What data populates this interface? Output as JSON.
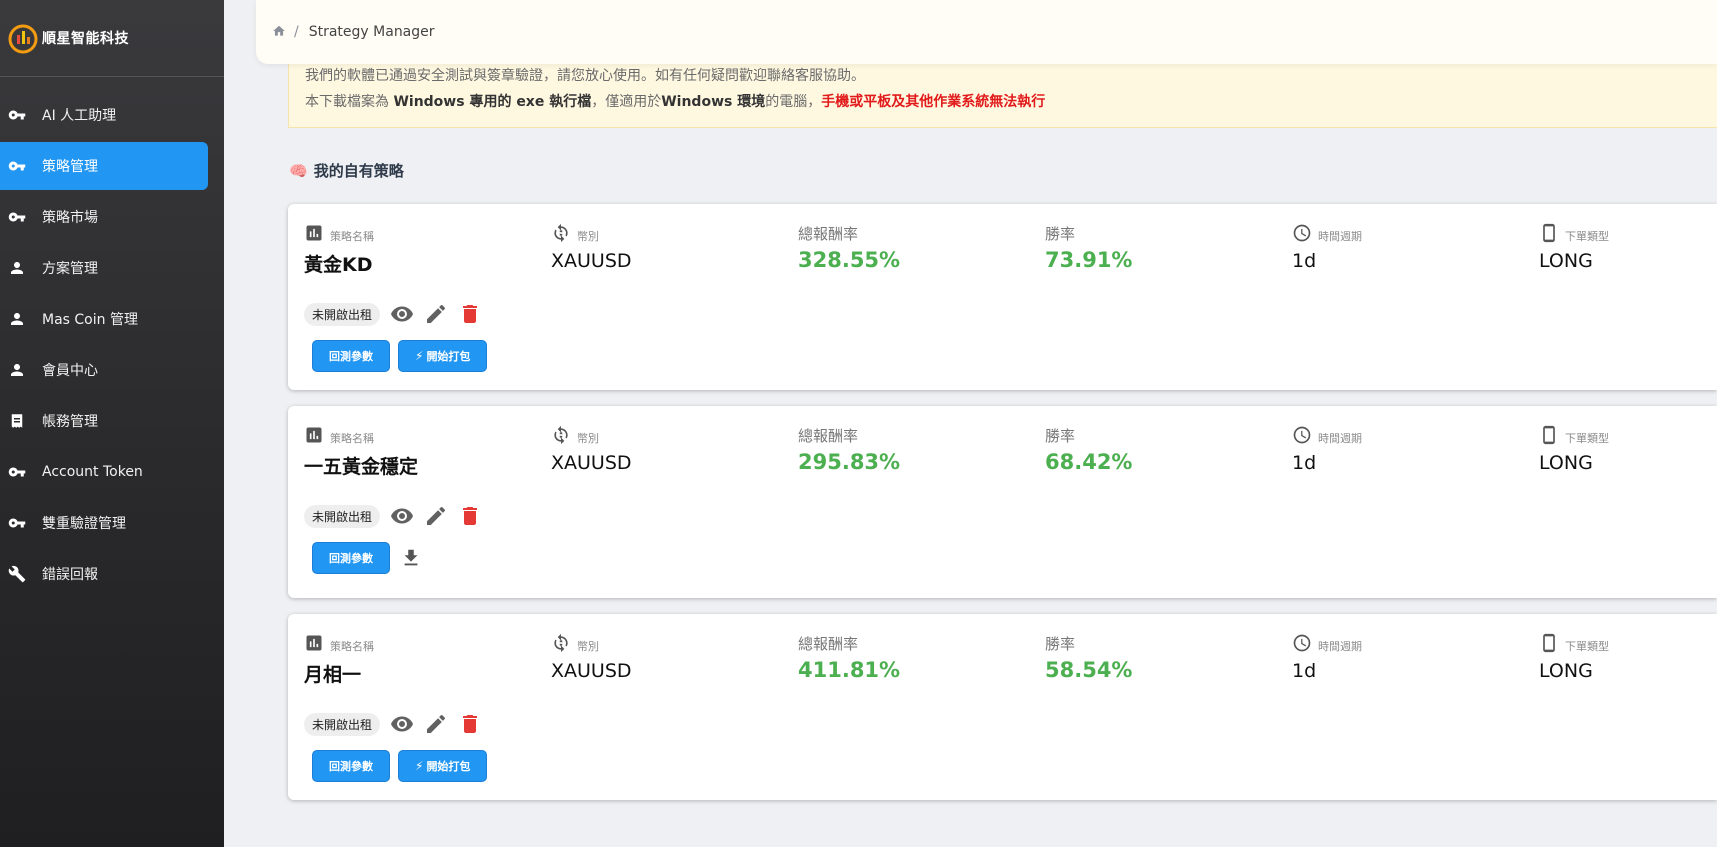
{
  "brand": {
    "name": "順星智能科技"
  },
  "sidebar": {
    "items": [
      {
        "label": "AI 人工助理",
        "icon": "key-icon",
        "active": false
      },
      {
        "label": "策略管理",
        "icon": "key-icon",
        "active": true
      },
      {
        "label": "策略市場",
        "icon": "key-icon",
        "active": false
      },
      {
        "label": "方案管理",
        "icon": "person-icon",
        "active": false
      },
      {
        "label": "Mas Coin 管理",
        "icon": "person-icon",
        "active": false
      },
      {
        "label": "會員中心",
        "icon": "person-icon",
        "active": false
      },
      {
        "label": "帳務管理",
        "icon": "receipt-icon",
        "active": false
      },
      {
        "label": "Account Token",
        "icon": "key-icon",
        "active": false
      },
      {
        "label": "雙重驗證管理",
        "icon": "key-icon",
        "active": false
      },
      {
        "label": "錯誤回報",
        "icon": "wrench-icon",
        "active": false
      }
    ]
  },
  "breadcrumb": {
    "separator": "/",
    "current": "Strategy Manager"
  },
  "notice": {
    "line1": "我們的軟體已通過安全測試與簽章驗證，請您放心使用。如有任何疑問歡迎聯絡客服協助。",
    "line2_a": "本下載檔案為 ",
    "line2_b": "Windows 專用的 exe 執行檔",
    "line2_c": "，僅適用於",
    "line2_d": "Windows 環境",
    "line2_e": "的電腦，",
    "line2_warn": "手機或平板及其他作業系統無法執行"
  },
  "section": {
    "icon": "🧠",
    "title": "我的自有策略"
  },
  "labels": {
    "name": "策略名稱",
    "symbol": "幣別",
    "return": "總報酬率",
    "winrate": "勝率",
    "timeframe": "時間週期",
    "order_type": "下單類型",
    "backtest_btn": "回測參數",
    "package_btn": "開始打包"
  },
  "strategies": [
    {
      "name": "黃金KD",
      "symbol": "XAUUSD",
      "return": "328.55%",
      "winrate": "73.91%",
      "timeframe": "1d",
      "order_type": "LONG",
      "status": "未開啟出租",
      "show_package": true
    },
    {
      "name": "一五黃金穩定",
      "symbol": "XAUUSD",
      "return": "295.83%",
      "winrate": "68.42%",
      "timeframe": "1d",
      "order_type": "LONG",
      "status": "未開啟出租",
      "show_package": false
    },
    {
      "name": "月相一",
      "symbol": "XAUUSD",
      "return": "411.81%",
      "winrate": "58.54%",
      "timeframe": "1d",
      "order_type": "LONG",
      "status": "未開啟出租",
      "show_package": true
    }
  ],
  "colors": {
    "accent": "#2196f3",
    "positive": "#4caf50",
    "danger": "#e53935",
    "warning_text": "#e11b1b"
  }
}
